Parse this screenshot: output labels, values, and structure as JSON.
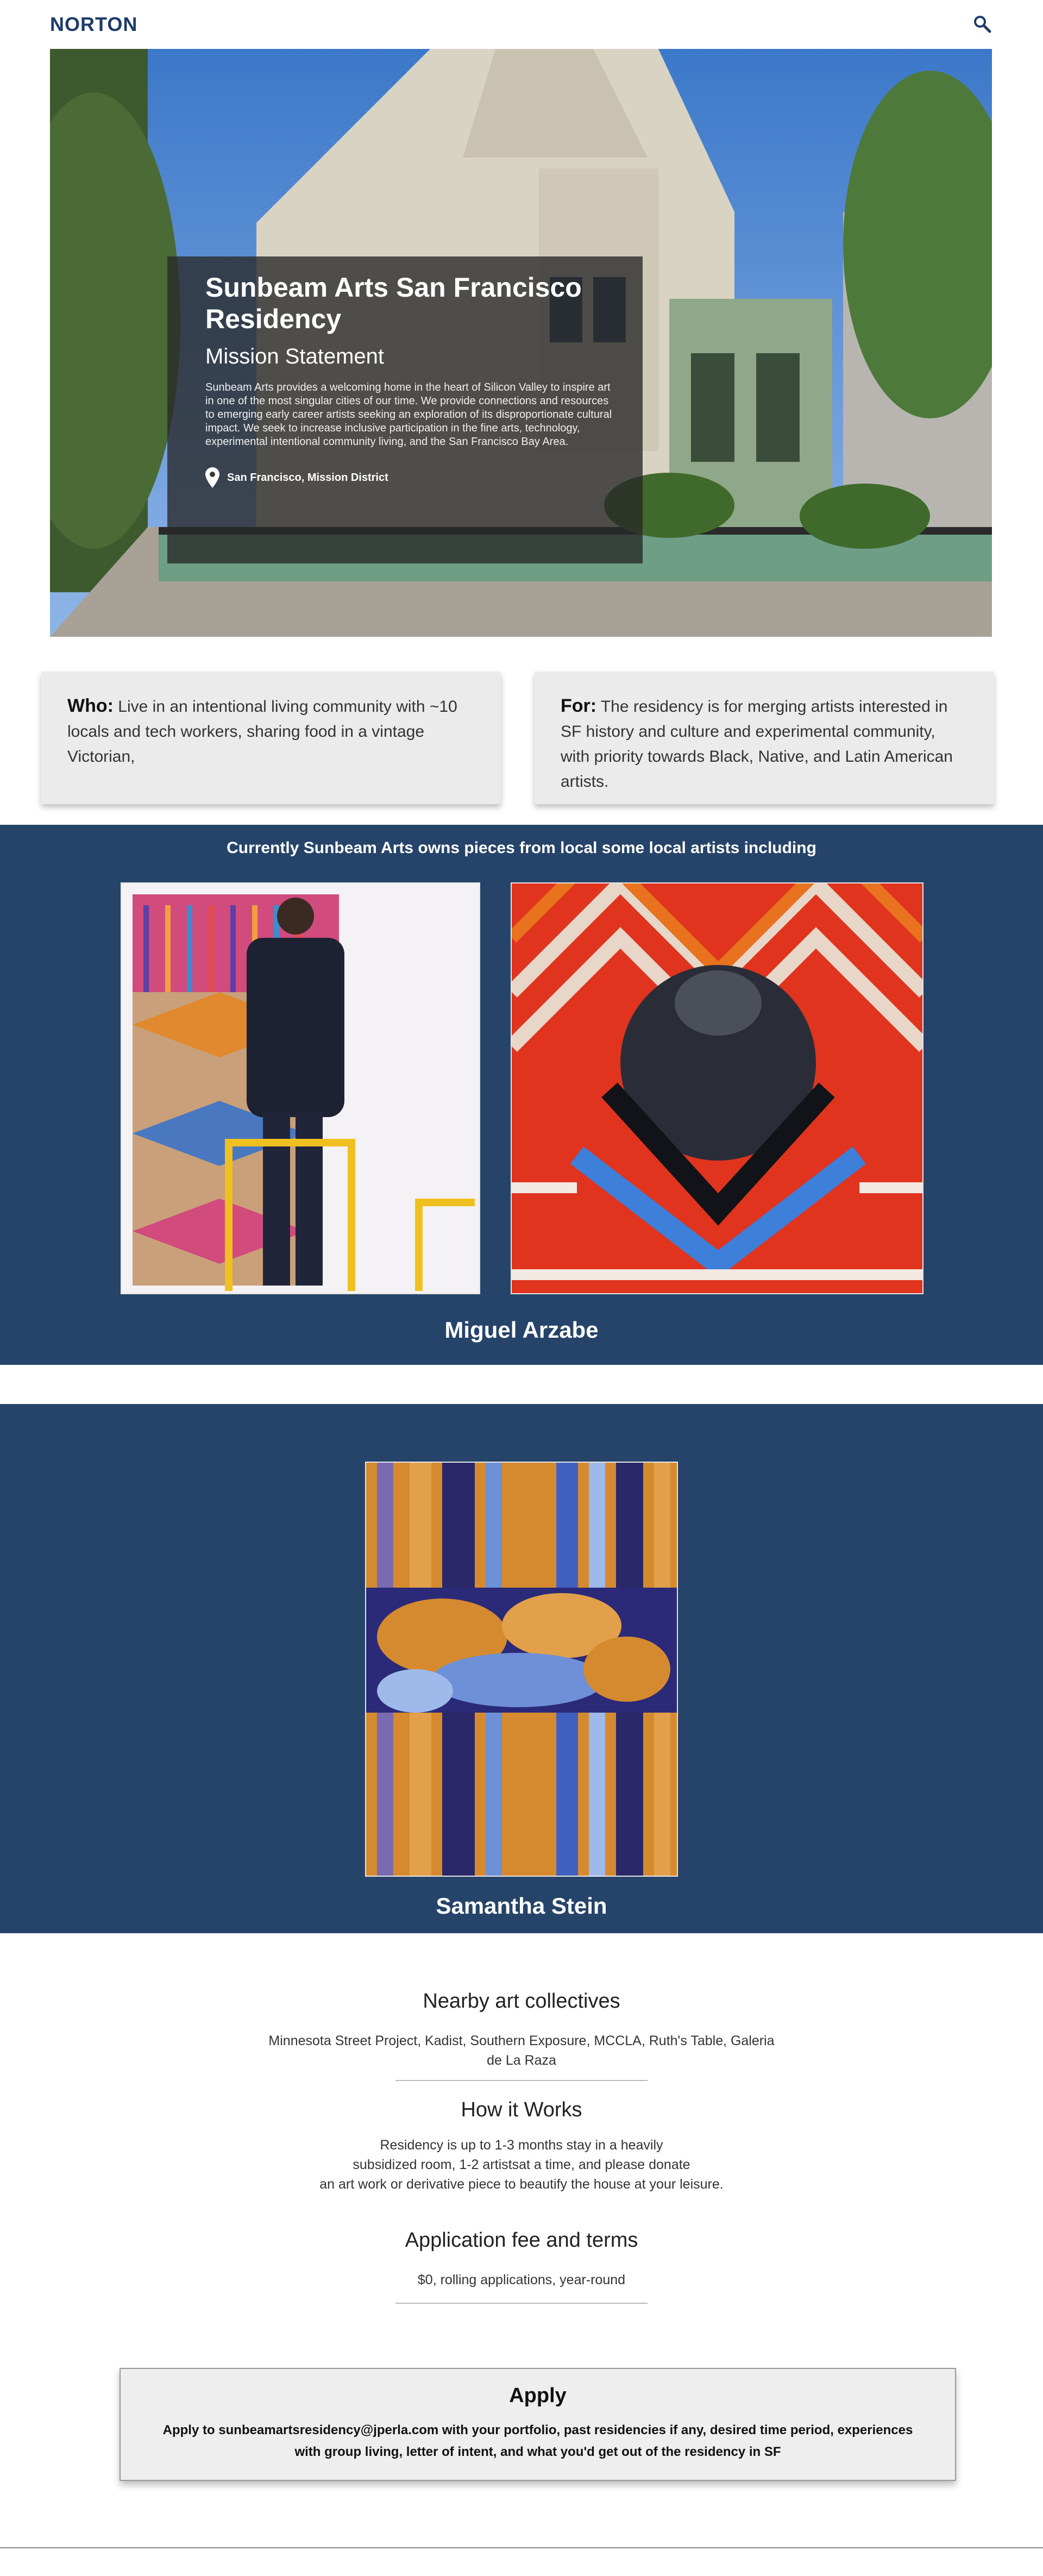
{
  "header": {
    "brand": "NORTON",
    "search_icon": "search-icon"
  },
  "hero": {
    "title": "Sunbeam Arts San Francisco Residency",
    "subtitle": "Mission Statement",
    "body": "Sunbeam Arts provides a welcoming home in the heart of Silicon Valley to inspire art in one of the most singular cities of our time. We provide connections and resources to emerging early career artists seeking an exploration of its disproportionate cultural impact. We seek to increase inclusive participation in the fine arts, technology, experimental intentional community living, and the San Francisco Bay Area.",
    "location": "San Francisco, Mission District",
    "location_icon": "map-pin-icon"
  },
  "who": {
    "label": "Who:",
    "text": "Live in an intentional living community with ~10 locals and tech workers, sharing food in a vintage Victorian,"
  },
  "for": {
    "label": "For:",
    "text": "The residency is for merging artists interested in SF history and culture and experimental community, with priority towards Black, Native, and Latin American artists."
  },
  "artists_section": {
    "title": "Currently Sunbeam Arts owns pieces from local some local artists including",
    "artist1": "Miguel Arzabe",
    "artist2": "Samantha Stein"
  },
  "collectives": {
    "title": "Nearby art collectives",
    "text": "Minnesota Street Project, Kadist, Southern Exposure, MCCLA, Ruth's Table, Galeria de La Raza"
  },
  "how": {
    "title": "How it Works",
    "line1": "Residency is up to 1-3 months stay in a heavily",
    "line2": "subsidized room, 1-2 artistsat a time, and please donate",
    "line3": "an art work or derivative piece to beautify the house at your leisure."
  },
  "fee": {
    "title": "Application fee and terms",
    "text": "$0, rolling applications, year-round"
  },
  "apply": {
    "title": "Apply",
    "line1": "Apply to sunbeamartsresidency@jperla.com with your portfolio, past residencies if any, desired time period, experiences",
    "line2": "with group living, letter of intent, and what you'd get out of the residency in SF"
  },
  "colors": {
    "brand": "#1f3a6b",
    "band": "#264469",
    "card": "#ebebeb"
  }
}
